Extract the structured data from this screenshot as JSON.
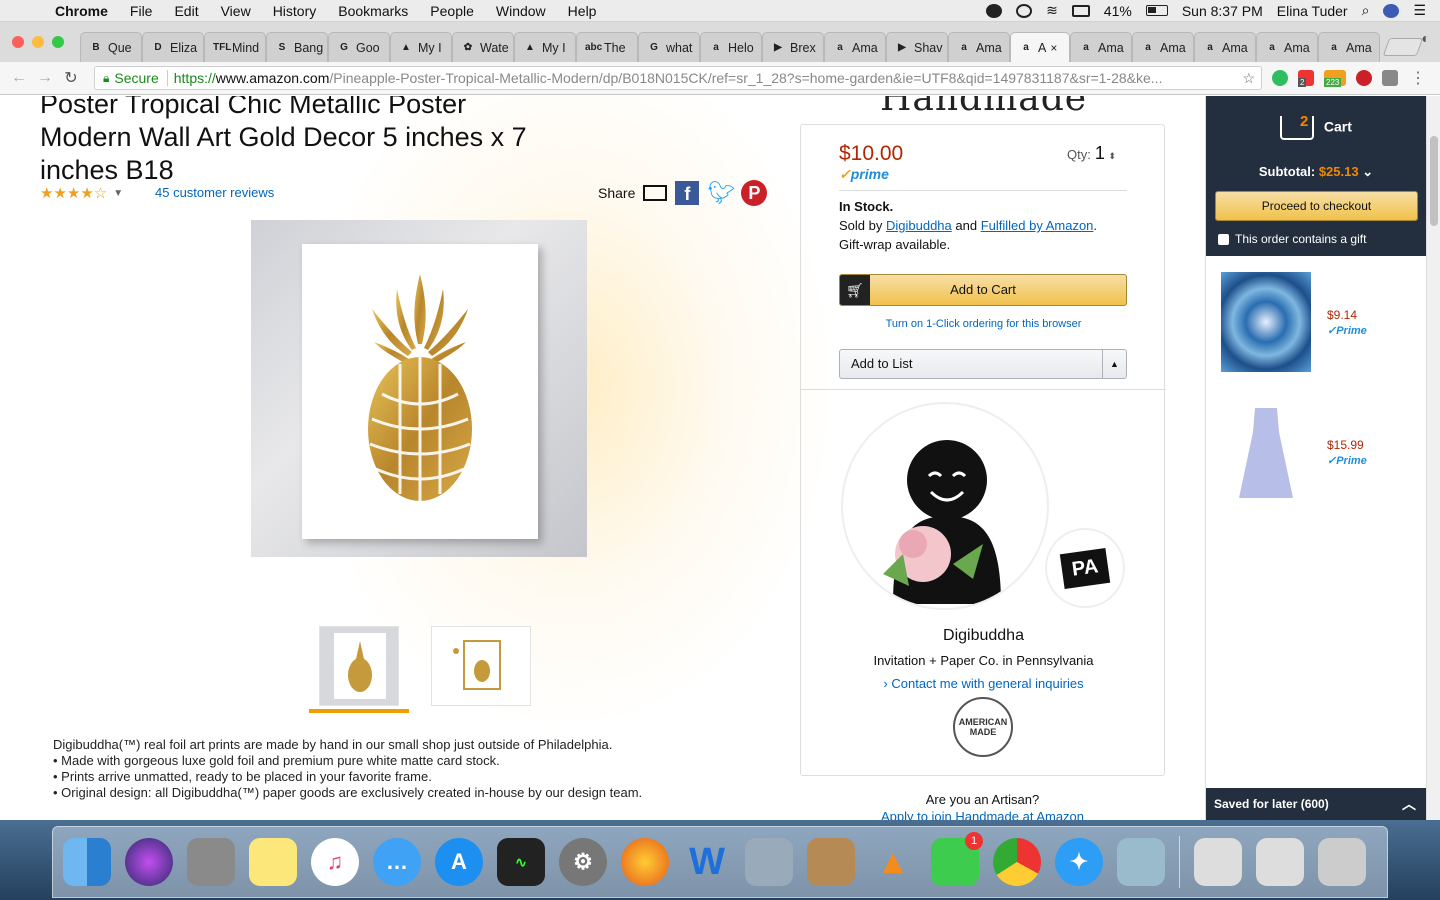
{
  "menubar": {
    "app": "Chrome",
    "items": [
      "File",
      "Edit",
      "View",
      "History",
      "Bookmarks",
      "People",
      "Window",
      "Help"
    ],
    "battery": "41%",
    "clock": "Sun 8:37 PM",
    "user": "Elina Tuder"
  },
  "tabs": [
    {
      "label": "Que",
      "fav": "B"
    },
    {
      "label": "Eliza",
      "fav": "D"
    },
    {
      "label": "Mind",
      "fav": "TFL"
    },
    {
      "label": "Bang",
      "fav": "S"
    },
    {
      "label": "Goo",
      "fav": "G"
    },
    {
      "label": "My I",
      "fav": "▲"
    },
    {
      "label": "Wate",
      "fav": "✿"
    },
    {
      "label": "My I",
      "fav": "▲"
    },
    {
      "label": "The",
      "fav": "abc"
    },
    {
      "label": "what",
      "fav": "G"
    },
    {
      "label": "Helo",
      "fav": "a"
    },
    {
      "label": "Brex",
      "fav": "▶"
    },
    {
      "label": "Ama",
      "fav": "a"
    },
    {
      "label": "Shav",
      "fav": "▶"
    },
    {
      "label": "Ama",
      "fav": "a"
    },
    {
      "label": "A",
      "fav": "a",
      "active": true
    },
    {
      "label": "Ama",
      "fav": "a"
    },
    {
      "label": "Ama",
      "fav": "a"
    },
    {
      "label": "Ama",
      "fav": "a"
    },
    {
      "label": "Ama",
      "fav": "a"
    },
    {
      "label": "Ama",
      "fav": "a"
    }
  ],
  "omnibox": {
    "secure_label": "Secure",
    "scheme": "https://",
    "domain": "www.amazon.com",
    "path": "/Pineapple-Poster-Tropical-Metallic-Modern/dp/B018N015CK/ref=sr_1_28?s=home-garden&ie=UTF8&qid=1497831187&sr=1-28&ke..."
  },
  "extensions": {
    "badge1": "2",
    "badge2": "223"
  },
  "product": {
    "title": "Poster Tropical Chic Metallic Poster Modern Wall Art Gold Decor 5 inches x 7 inches B18",
    "stars": "★★★★☆",
    "rating": 4,
    "reviews": "45 customer reviews",
    "share_label": "Share",
    "description": [
      "Digibuddha(™) real foil art prints are made by hand in our small shop just outside of Philadelphia.",
      "• Made with gorgeous luxe gold foil and premium pure white matte card stock.",
      "• Prints arrive unmatted, ready to be placed in your favorite frame.",
      "• Original design: all Digibuddha(™) paper goods are exclusively created in-house by our design team."
    ]
  },
  "buybox": {
    "brand_header": "Handmade",
    "price": "$10.00",
    "prime": "prime",
    "qty_label": "Qty:",
    "qty_value": "1",
    "stock": "In Stock.",
    "sold_by_prefix": "Sold by ",
    "seller_link": "Digibuddha",
    "and": " and ",
    "fulfilled_link": "Fulfilled by Amazon",
    "period": ".",
    "giftwrap": "Gift-wrap available.",
    "add_to_cart": "Add to Cart",
    "one_click": "Turn on 1-Click ordering for this browser",
    "add_to_list": "Add to List",
    "state_badge": "PA",
    "seller_name": "Digibuddha",
    "seller_sub": "Invitation + Paper Co. in Pennsylvania",
    "contact": "Contact me with general inquiries",
    "badge_text": "AMERICAN MADE",
    "artisan_q": "Are you an Artisan?",
    "artisan_link": "Apply to join Handmade at Amazon"
  },
  "cart": {
    "count": "2",
    "label": "Cart",
    "subtotal_label": "Subtotal: ",
    "subtotal": "$25.13",
    "checkout": "Proceed to checkout",
    "gift": "This order contains a gift",
    "items": [
      {
        "price": "$9.14",
        "prime": "✓Prime"
      },
      {
        "price": "$15.99",
        "prime": "✓Prime"
      }
    ],
    "saved": "Saved for later (600)"
  },
  "dock": {
    "facetime_badge": "1"
  },
  "colors": {
    "amazon_navy": "#232f3e",
    "amazon_orange": "#f08804",
    "price_red": "#b12704",
    "link_blue": "#0066c0"
  }
}
